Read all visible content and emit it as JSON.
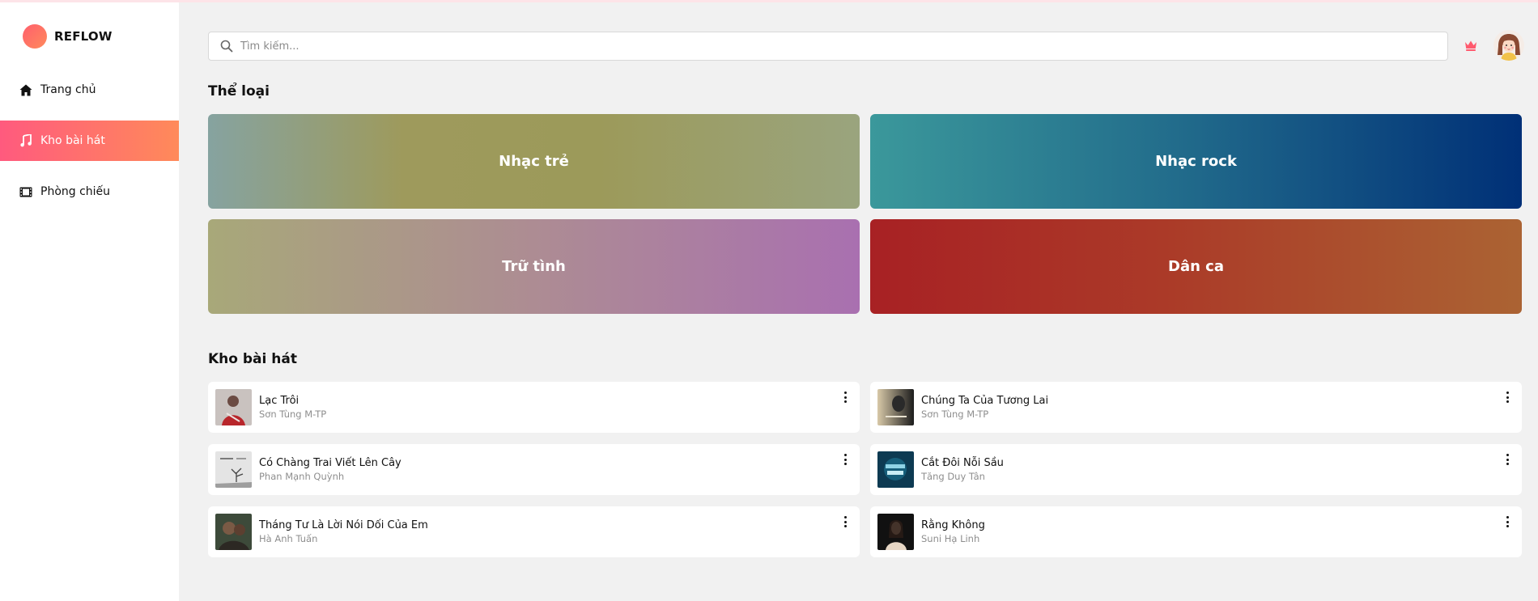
{
  "brand": {
    "name": "REFLOW"
  },
  "sidebar": {
    "items": [
      {
        "label": "Trang chủ",
        "icon": "home-icon",
        "active": false
      },
      {
        "label": "Kho bài hát",
        "icon": "music-note-icon",
        "active": true
      },
      {
        "label": "Phòng chiếu",
        "icon": "film-icon",
        "active": false
      }
    ]
  },
  "header": {
    "search_placeholder": "Tìm kiếm...",
    "premium_icon": "crown-icon",
    "avatar_icon": "user-avatar"
  },
  "genres": {
    "title": "Thể loại",
    "items": [
      {
        "label": "Nhạc trẻ"
      },
      {
        "label": "Nhạc rock"
      },
      {
        "label": "Trữ tình"
      },
      {
        "label": "Dân ca"
      }
    ]
  },
  "songs": {
    "title": "Kho bài hát",
    "items": [
      {
        "title": "Lạc Trôi",
        "artist": "Sơn Tùng M-TP"
      },
      {
        "title": "Chúng Ta Của Tương Lai",
        "artist": "Sơn Tùng M-TP"
      },
      {
        "title": "Có Chàng Trai Viết Lên Cây",
        "artist": "Phan Mạnh Quỳnh"
      },
      {
        "title": "Cắt Đôi Nỗi Sầu",
        "artist": "Tăng Duy Tân"
      },
      {
        "title": "Tháng Tư Là Lời Nói Dối Của Em",
        "artist": "Hà Anh Tuấn"
      },
      {
        "title": "Rằng Không",
        "artist": "Suni Hạ Linh"
      }
    ]
  },
  "colors": {
    "accent_start": "#ff5a7e",
    "accent_end": "#ff8a5a",
    "background": "#f1f1f1"
  }
}
